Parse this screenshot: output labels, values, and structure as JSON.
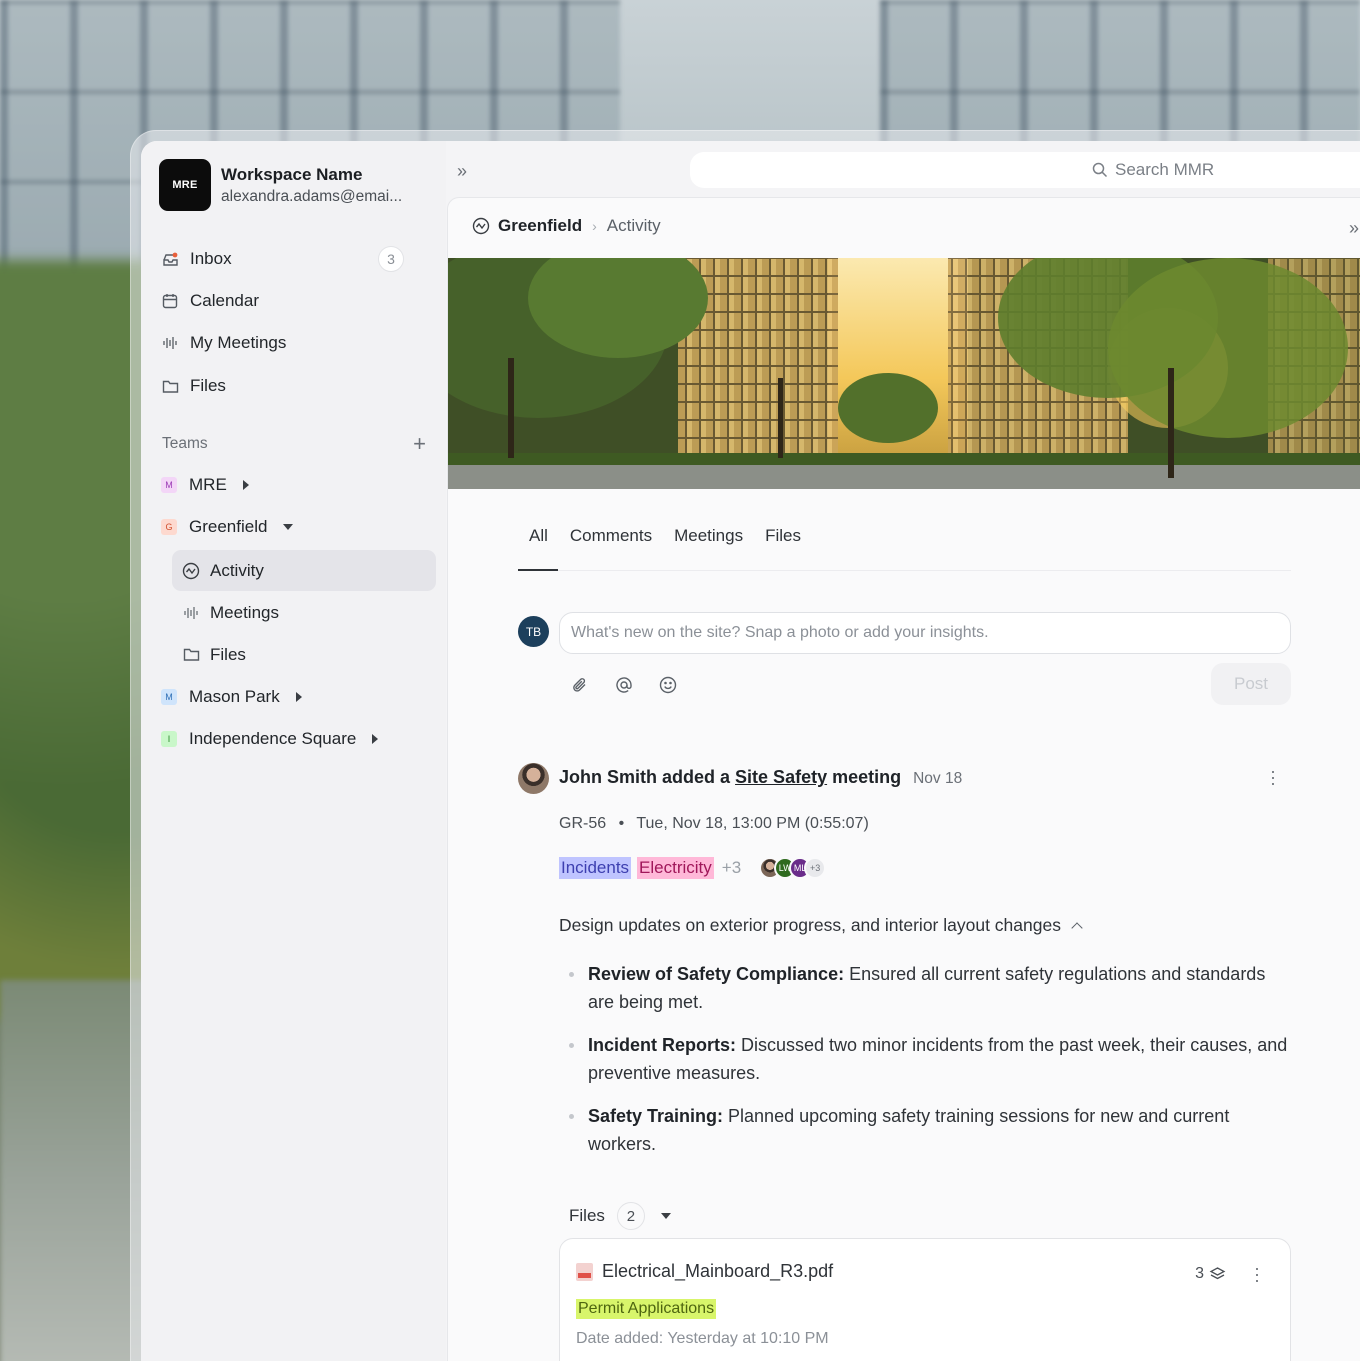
{
  "workspace": {
    "logo": "MRE",
    "name": "Workspace Name",
    "email": "alexandra.adams@emai..."
  },
  "nav": [
    {
      "label": "Inbox",
      "icon": "inbox-icon",
      "badge": "3"
    },
    {
      "label": "Calendar",
      "icon": "calendar-icon"
    },
    {
      "label": "My Meetings",
      "icon": "waveform-icon"
    },
    {
      "label": "Files",
      "icon": "folder-icon"
    }
  ],
  "teams": {
    "heading": "Teams",
    "items": [
      {
        "letter": "M",
        "label": "MRE",
        "color": "#f3d6f7",
        "text_color": "#9b3bb5",
        "expanded": false
      },
      {
        "letter": "G",
        "label": "Greenfield",
        "color": "#fdd9cf",
        "text_color": "#d0502f",
        "expanded": true,
        "children": [
          {
            "label": "Activity",
            "icon": "activity-icon",
            "active": true
          },
          {
            "label": "Meetings",
            "icon": "waveform-icon"
          },
          {
            "label": "Files",
            "icon": "folder-icon"
          }
        ]
      },
      {
        "letter": "M",
        "label": "Mason Park",
        "color": "#cfe4fb",
        "text_color": "#2f6fb5",
        "expanded": false
      },
      {
        "letter": "I",
        "label": "Independence Square",
        "color": "#c9f7c9",
        "text_color": "#2b8a2b",
        "expanded": false
      }
    ]
  },
  "search": {
    "placeholder": "Search MMR"
  },
  "breadcrumb": {
    "project": "Greenfield",
    "page": "Activity"
  },
  "tabs": [
    "All",
    "Comments",
    "Meetings",
    "Files"
  ],
  "composer": {
    "avatar": "TB",
    "placeholder": "What's new on the site? Snap a photo or add your insights.",
    "post_label": "Post"
  },
  "activity": {
    "actor": "John Smith",
    "verb": "added a",
    "link": "Site Safety",
    "object": "meeting",
    "date": "Nov 18",
    "meta_id": "GR-56",
    "meta_dot": "•",
    "meta_time": "Tue, Nov 18, 13:00 PM (0:55:07)",
    "tags": [
      "Incidents",
      "Electricity"
    ],
    "tags_more": "+3",
    "attendees": [
      {
        "initials": "",
        "color": "#7b6657"
      },
      {
        "initials": "LW",
        "color": "#2f6b1f"
      },
      {
        "initials": "ML",
        "color": "#6a2c8a"
      },
      {
        "initials": "+3",
        "color": "#e8e9ec"
      }
    ],
    "summary": "Design updates on exterior progress, and interior layout changes",
    "points": [
      {
        "title": "Review of Safety Compliance:",
        "text": " Ensured all current safety regulations and standards are being met."
      },
      {
        "title": "Incident Reports:",
        "text": " Discussed two minor incidents from the past week, their causes, and preventive measures."
      },
      {
        "title": "Safety Training:",
        "text": " Planned upcoming safety training sessions for new and current workers."
      }
    ],
    "files_label": "Files",
    "files_count": "2",
    "file": {
      "name": "Electrical_Mainboard_R3.pdf",
      "versions": "3",
      "tag": "Permit Applications",
      "date": "Date added: Yesterday at 10:10 PM"
    }
  }
}
